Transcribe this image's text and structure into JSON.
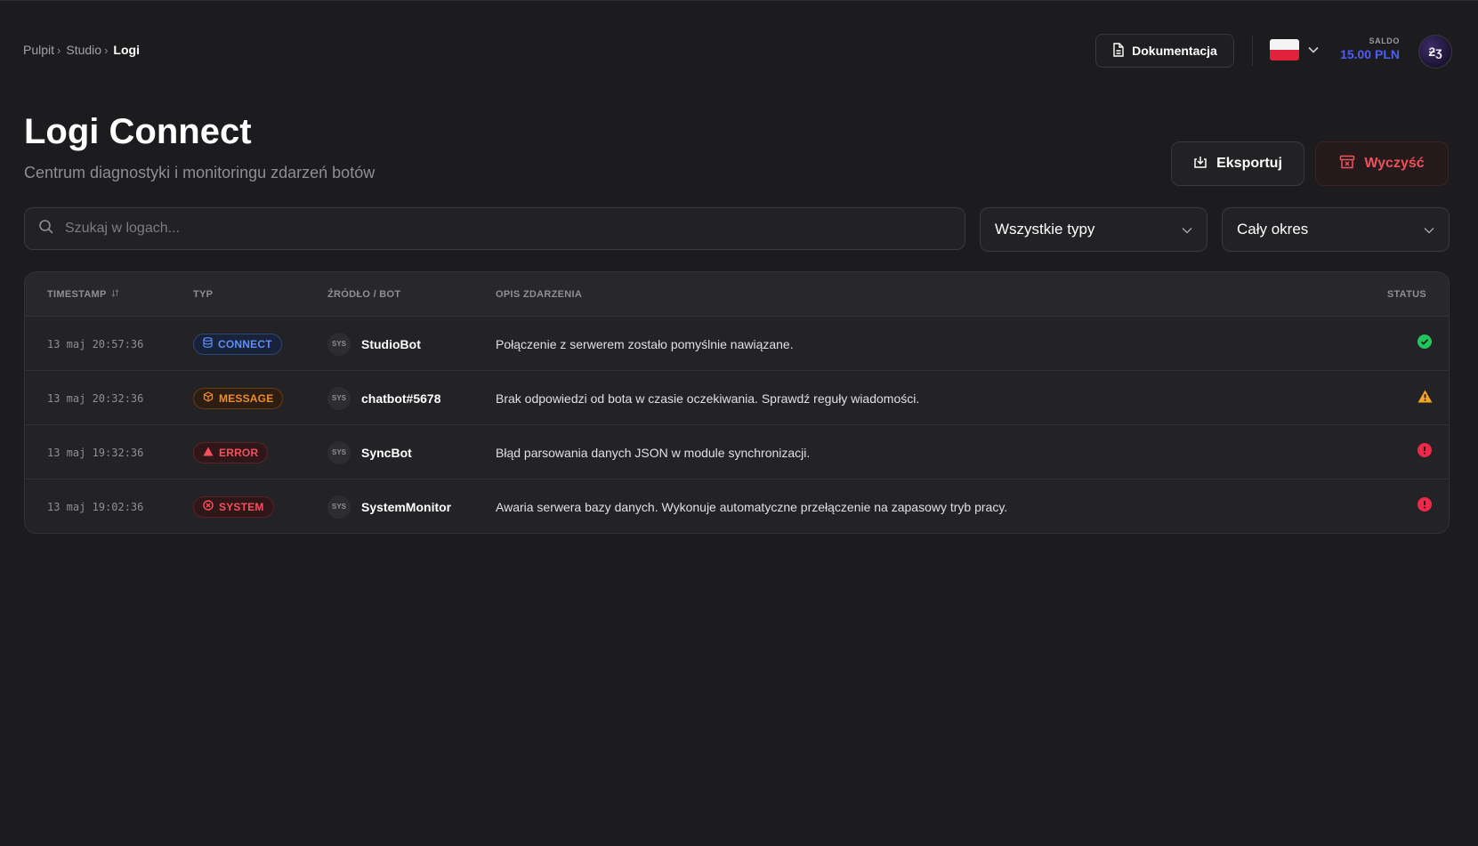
{
  "breadcrumb": {
    "items": [
      "Pulpit",
      "Studio"
    ],
    "current": "Logi"
  },
  "header": {
    "docs_label": "Dokumentacja",
    "balance_label": "SALDO",
    "balance_value": "15.00 PLN",
    "avatar_text": "ƻʒ"
  },
  "page": {
    "title": "Logi Connect",
    "subtitle": "Centrum diagnostyki i monitoringu zdarzeń botów",
    "export_label": "Eksportuj",
    "clear_label": "Wyczyść"
  },
  "filters": {
    "search_placeholder": "Szukaj w logach...",
    "type_value": "Wszystkie typy",
    "period_value": "Cały okres"
  },
  "table": {
    "headers": {
      "timestamp": "TIMESTAMP",
      "type": "TYP",
      "source": "ŹRÓDŁO / BOT",
      "description": "OPIS ZDARZENIA",
      "status": "STATUS"
    },
    "rows": [
      {
        "timestamp": "13 maj 20:57:36",
        "type": "CONNECT",
        "source_tag": "SYS",
        "bot": "StudioBot",
        "description": "Połączenie z serwerem zostało pomyślnie nawiązane.",
        "status": "success"
      },
      {
        "timestamp": "13 maj 20:32:36",
        "type": "MESSAGE",
        "source_tag": "SYS",
        "bot": "chatbot#5678",
        "description": "Brak odpowiedzi od bota w czasie oczekiwania. Sprawdź reguły wiadomości.",
        "status": "warning"
      },
      {
        "timestamp": "13 maj 19:32:36",
        "type": "ERROR",
        "source_tag": "SYS",
        "bot": "SyncBot",
        "description": "Błąd parsowania danych JSON w module synchronizacji.",
        "status": "error"
      },
      {
        "timestamp": "13 maj 19:02:36",
        "type": "SYSTEM",
        "source_tag": "SYS",
        "bot": "SystemMonitor",
        "description": "Awaria serwera bazy danych. Wykonuje automatyczne przełączenie na zapasowy tryb pracy.",
        "status": "error"
      }
    ]
  },
  "colors": {
    "background": "#1c1c1e",
    "accent_blue": "#4c5dff",
    "danger": "#f0505a",
    "success": "#22c55e",
    "warning": "#f5a623"
  }
}
